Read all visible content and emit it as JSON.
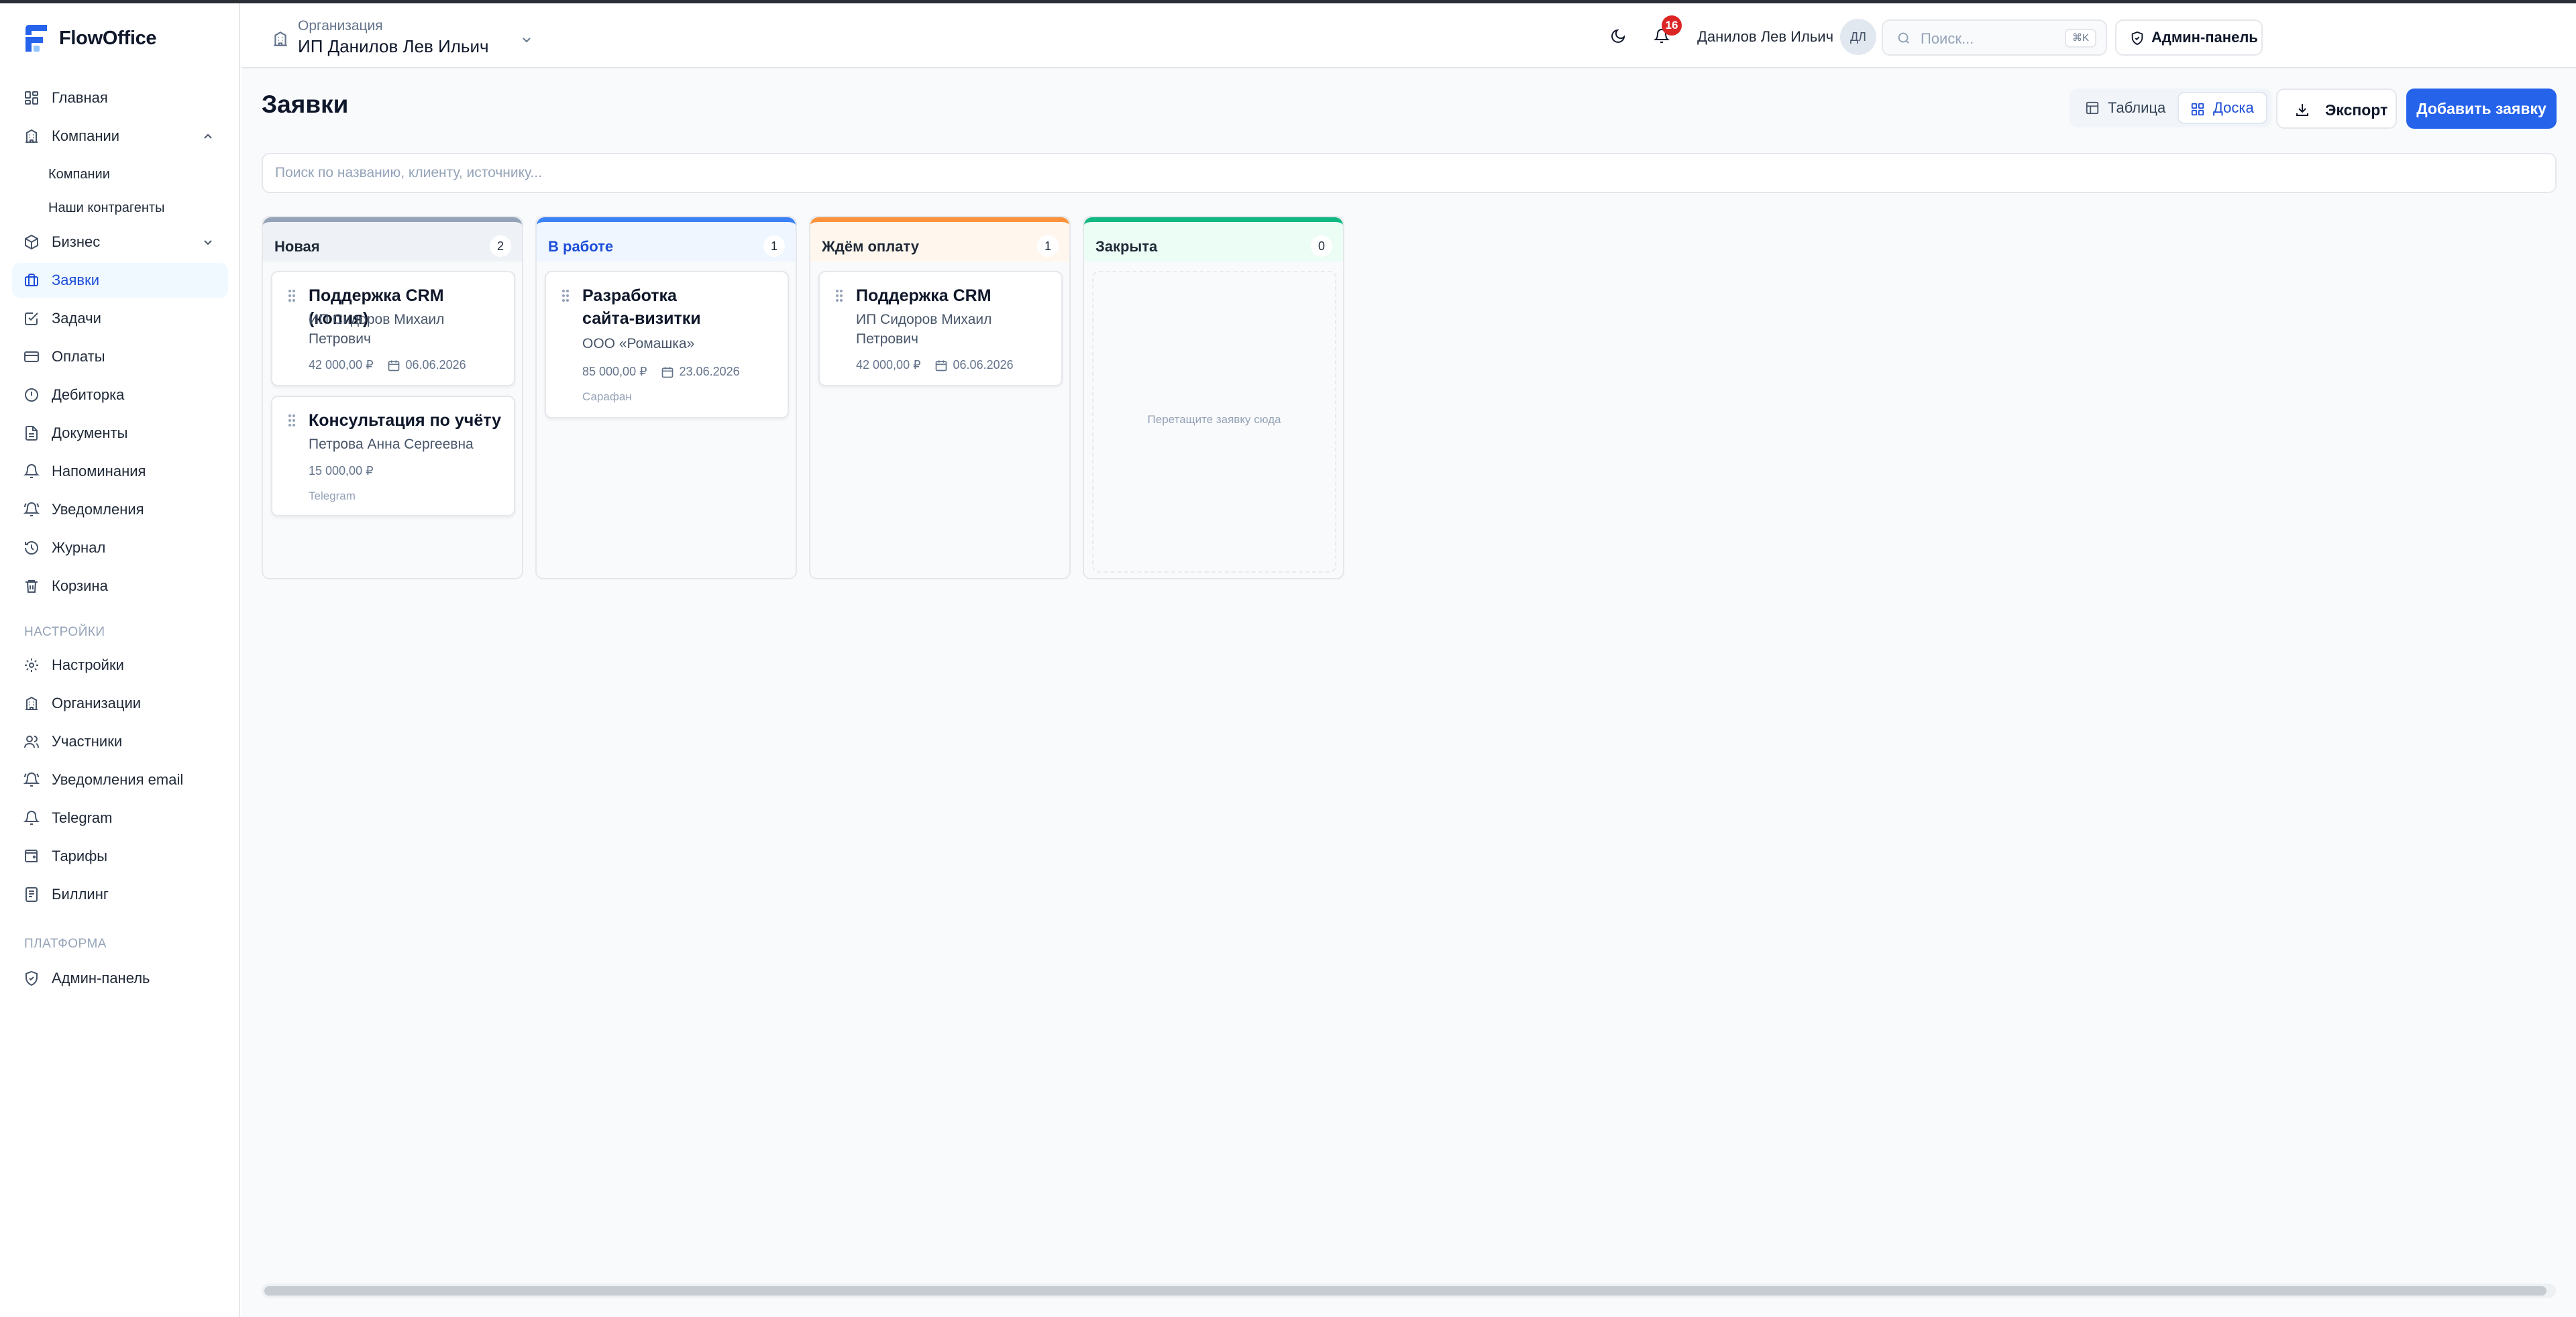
{
  "app": {
    "name": "FlowOffice"
  },
  "sidebar": {
    "items": [
      {
        "label": "Главная"
      },
      {
        "label": "Компании"
      },
      {
        "label": "Бизнес"
      },
      {
        "label": "Заявки"
      },
      {
        "label": "Задачи"
      },
      {
        "label": "Оплаты"
      },
      {
        "label": "Дебиторка"
      },
      {
        "label": "Документы"
      },
      {
        "label": "Напоминания"
      },
      {
        "label": "Уведомления"
      },
      {
        "label": "Журнал"
      },
      {
        "label": "Корзина"
      }
    ],
    "companies_sub": [
      {
        "label": "Компании"
      },
      {
        "label": "Наши контрагенты"
      }
    ],
    "settings_section": "НАСТРОЙКИ",
    "settings_items": [
      {
        "label": "Настройки"
      },
      {
        "label": "Организации"
      },
      {
        "label": "Участники"
      },
      {
        "label": "Уведомления email"
      },
      {
        "label": "Telegram"
      },
      {
        "label": "Тарифы"
      },
      {
        "label": "Биллинг"
      }
    ],
    "platform_section": "ПЛАТФОРМА",
    "platform_items": [
      {
        "label": "Админ-панель"
      }
    ]
  },
  "header": {
    "org_caption": "Организация",
    "org_name": "ИП Данилов Лев Ильич",
    "search_placeholder": "Поиск...",
    "search_shortcut": "⌘K",
    "admin_label": "Админ-панель",
    "notifications_count": "16",
    "user_name": "Данилов Лев Ильич",
    "user_initials": "ДЛ"
  },
  "page": {
    "title": "Заявки",
    "view_table": "Таблица",
    "view_board": "Доска",
    "export_label": "Экспорт",
    "add_label": "Добавить заявку",
    "search_placeholder": "Поиск по названию, клиенту, источнику..."
  },
  "board": {
    "columns": [
      {
        "title": "Новая",
        "count": "2",
        "cards": [
          {
            "title": "Поддержка CRM (копия)",
            "client": "ИП Сидоров Михаил Петрович",
            "amount": "42 000,00 ₽",
            "date": "06.06.2026"
          },
          {
            "title": "Консультация по учёту",
            "client": "Петрова Анна Сергеевна",
            "amount": "15 000,00 ₽",
            "source": "Telegram"
          }
        ]
      },
      {
        "title": "В работе",
        "count": "1",
        "cards": [
          {
            "title": "Разработка сайта-визитки",
            "client": "ООО «Ромашка»",
            "amount": "85 000,00 ₽",
            "date": "23.06.2026",
            "source": "Сарафан"
          }
        ]
      },
      {
        "title": "Ждём оплату",
        "count": "1",
        "cards": [
          {
            "title": "Поддержка CRM",
            "client": "ИП Сидоров Михаил Петрович",
            "amount": "42 000,00 ₽",
            "date": "06.06.2026"
          }
        ]
      },
      {
        "title": "Закрыта",
        "count": "0",
        "empty_text": "Перетащите заявку сюда"
      }
    ]
  },
  "colors": {
    "accent": "#2563eb",
    "col_new": "#94a3b8",
    "col_in_progress": "#3b82f6",
    "col_awaiting_payment": "#fb923c",
    "col_closed": "#10b981",
    "badge": "#dc2626"
  }
}
